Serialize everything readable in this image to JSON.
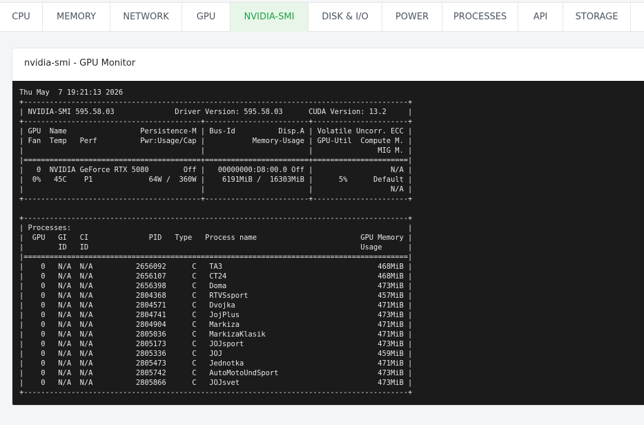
{
  "tabs": [
    {
      "label": "CPU",
      "active": false
    },
    {
      "label": "MEMORY",
      "active": false
    },
    {
      "label": "NETWORK",
      "active": false
    },
    {
      "label": "GPU",
      "active": false
    },
    {
      "label": "NVIDIA-SMI",
      "active": true
    },
    {
      "label": "DISK & I/O",
      "active": false
    },
    {
      "label": "POWER",
      "active": false
    },
    {
      "label": "PROCESSES",
      "active": false
    },
    {
      "label": "API",
      "active": false
    },
    {
      "label": "STORAGE",
      "active": false
    }
  ],
  "panel": {
    "title": "nvidia-smi - GPU Monitor"
  },
  "colors": {
    "accent": "#22a046",
    "active_tab_bg": "#e8f6ea",
    "terminal_bg": "#1b1b1b",
    "terminal_text": "#e6e6e6"
  },
  "output": "Thu May  7 19:21:13 2026\n+-----------------------------------------------------------------------------------------+\n| NVIDIA-SMI 595.58.03              Driver Version: 595.58.03      CUDA Version: 13.2     |\n+-----------------------------------------+------------------------+----------------------+\n| GPU  Name                 Persistence-M | Bus-Id          Disp.A | Volatile Uncorr. ECC |\n| Fan  Temp   Perf          Pwr:Usage/Cap |           Memory-Usage | GPU-Util  Compute M. |\n|                                         |                        |               MIG M. |\n|=========================================+========================+======================|\n|   0  NVIDIA GeForce RTX 5080        Off |   00000000:D8:00.0 Off |                  N/A |\n|  0%   45C    P1             64W /  360W |    6191MiB /  16303MiB |      5%      Default |\n|                                         |                        |                  N/A |\n+-----------------------------------------+------------------------+----------------------+\n\n+-----------------------------------------------------------------------------------------+\n| Processes:                                                                              |\n|  GPU   GI   CI              PID   Type   Process name                        GPU Memory |\n|        ID   ID                                                               Usage      |\n|=========================================================================================|\n|    0   N/A  N/A          2656092      C   TA3                                    468MiB |\n|    0   N/A  N/A          2656107      C   CT24                                   468MiB |\n|    0   N/A  N/A          2656398      C   Doma                                   473MiB |\n|    0   N/A  N/A          2804368      C   RTVSsport                              457MiB |\n|    0   N/A  N/A          2804571      C   Dvojka                                 471MiB |\n|    0   N/A  N/A          2804741      C   JojPlus                                473MiB |\n|    0   N/A  N/A          2804904      C   Markiza                                471MiB |\n|    0   N/A  N/A          2805036      C   MarkizaKlasik                          471MiB |\n|    0   N/A  N/A          2805173      C   JOJsport                               473MiB |\n|    0   N/A  N/A          2805336      C   JOJ                                    459MiB |\n|    0   N/A  N/A          2805473      C   Jednotka                               471MiB |\n|    0   N/A  N/A          2805742      C   AutoMotoUndSport                       473MiB |\n|    0   N/A  N/A          2805866      C   JOJsvet                                473MiB |\n+-----------------------------------------------------------------------------------------+"
}
